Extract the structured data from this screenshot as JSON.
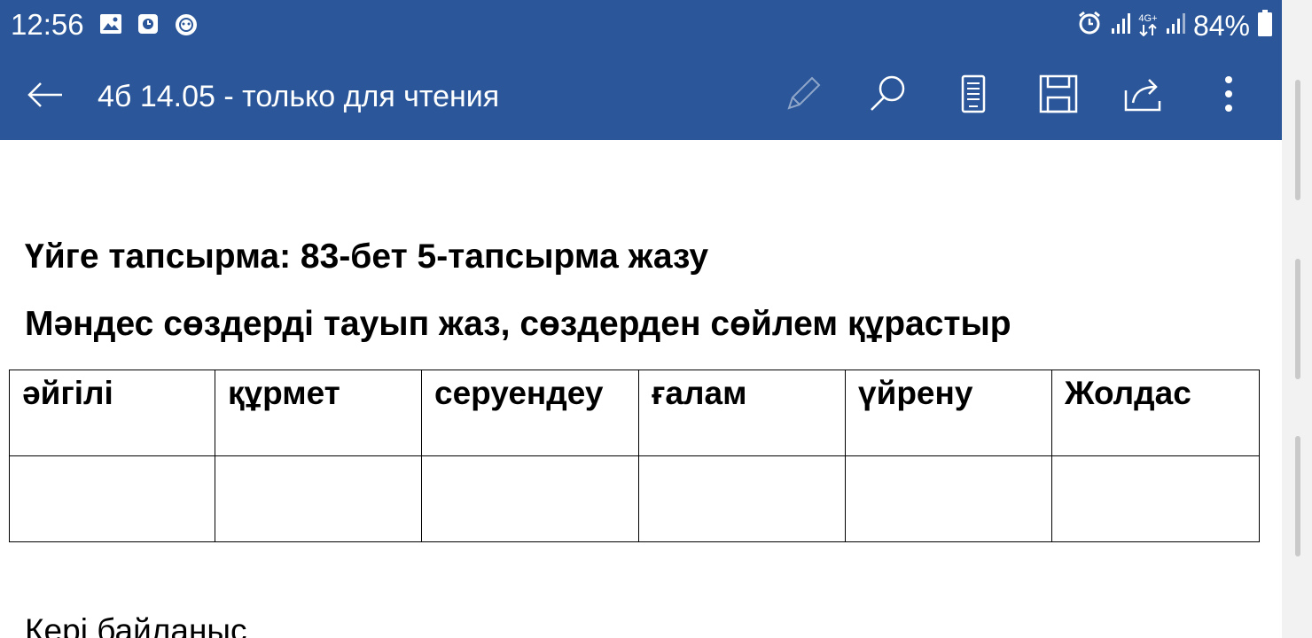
{
  "status_bar": {
    "time": "12:56",
    "left_icons": [
      "image-icon",
      "clock-app-icon",
      "shield-app-icon"
    ],
    "right_icons": [
      "alarm-icon",
      "signal-icon",
      "4g-data-icon",
      "signal-icon"
    ],
    "network_label": "4G+",
    "battery_percent": "84%"
  },
  "app_bar": {
    "title": "4б 14.05 - только для чтения",
    "toolbar": [
      "pencil-icon",
      "search-icon",
      "mobile-view-icon",
      "save-icon",
      "share-icon",
      "more-vert-icon"
    ],
    "background_color": "#2b579a"
  },
  "document": {
    "heading_homework": "Үйге тапсырма: 83-бет 5-тапсырма жазу",
    "heading_task": "Мәндес сөздерді тауып жаз, сөздерден сөйлем құрастыр",
    "table": {
      "row1": [
        "әйгілі",
        "құрмет",
        "серуендеу",
        "ғалам",
        "үйрену",
        "Жолдас"
      ],
      "row2": [
        "",
        "",
        "",
        "",
        "",
        ""
      ]
    },
    "feedback": "Кері байланыс"
  }
}
